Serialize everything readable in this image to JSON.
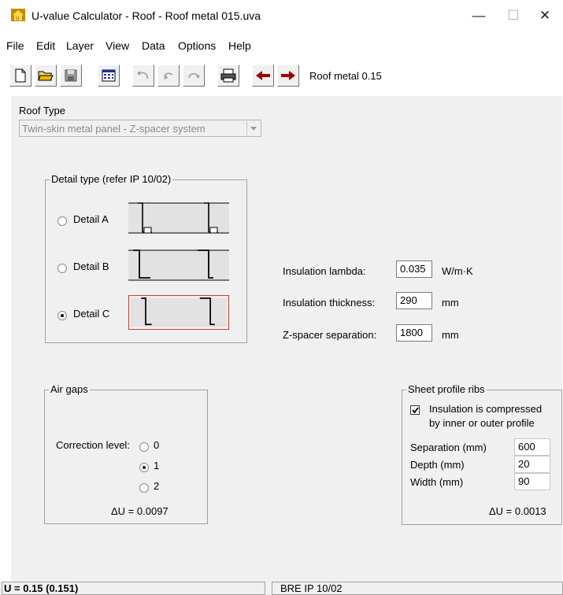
{
  "window": {
    "title": "U-value Calculator - Roof - Roof metal 015.uva",
    "minimize": "—",
    "maximize": "☐",
    "close": "✕"
  },
  "menu": [
    "File",
    "Edit",
    "Layer",
    "View",
    "Data",
    "Options",
    "Help"
  ],
  "toolbar": {
    "buttons": [
      "new-icon",
      "open-icon",
      "save-icon",
      "calculator-icon",
      "undo-icon",
      "undo2-icon",
      "redo-icon",
      "print-icon",
      "back-arrow-icon",
      "forward-arrow-icon"
    ],
    "current_label": "Roof metal 0.15"
  },
  "roof_type": {
    "label": "Roof Type",
    "value": "Twin-skin metal panel - Z-spacer system"
  },
  "detail_type": {
    "group_label": "Detail type (refer IP 10/02)",
    "options": [
      "Detail A",
      "Detail B",
      "Detail C"
    ],
    "selected": "Detail C"
  },
  "insulation": {
    "lambda_label": "Insulation lambda:",
    "lambda_value": "0.035",
    "lambda_unit": "W/m·K",
    "thickness_label": "Insulation thickness:",
    "thickness_value": "290",
    "thickness_unit": "mm",
    "zspacer_label": "Z-spacer separation:",
    "zspacer_value": "1800",
    "zspacer_unit": "mm"
  },
  "air_gaps": {
    "group_label": "Air gaps",
    "correction_label": "Correction level:",
    "levels": [
      "0",
      "1",
      "2"
    ],
    "selected": "1",
    "delta_u": "ΔU =  0.0097"
  },
  "sheet_profile": {
    "group_label": "Sheet profile ribs",
    "checkbox_line1": "Insulation is compressed",
    "checkbox_line2": "by inner or outer profile",
    "checked": true,
    "separation_label": "Separation (mm)",
    "separation_value": "600",
    "depth_label": "Depth (mm)",
    "depth_value": "20",
    "width_label": "Width (mm)",
    "width_value": "90",
    "delta_u": "ΔU =  0.0013"
  },
  "status": {
    "left": "U = 0.15  (0.151)",
    "right": "BRE IP 10/02"
  },
  "colors": {
    "selected_detail_border": "#c8402a",
    "toolbar_arrow": "#a00000"
  }
}
